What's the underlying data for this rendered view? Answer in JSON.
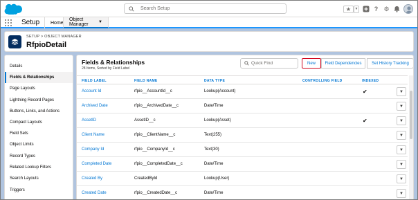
{
  "header": {
    "search_placeholder": "Search Setup",
    "icons": [
      "star-icon",
      "chevron-down-icon",
      "plus-icon",
      "help-icon",
      "gear-icon",
      "bell-icon",
      "avatar"
    ]
  },
  "context_bar": {
    "app_name": "Setup",
    "tabs": [
      {
        "label": "Home"
      },
      {
        "label": "Object Manager"
      }
    ]
  },
  "page_header": {
    "breadcrumb": "SETUP > OBJECT MANAGER",
    "title": "RfpioDetail"
  },
  "sidebar": {
    "items": [
      {
        "label": "Details"
      },
      {
        "label": "Fields & Relationships"
      },
      {
        "label": "Page Layouts"
      },
      {
        "label": "Lightning Record Pages"
      },
      {
        "label": "Buttons, Links, and Actions"
      },
      {
        "label": "Compact Layouts"
      },
      {
        "label": "Field Sets"
      },
      {
        "label": "Object Limits"
      },
      {
        "label": "Record Types"
      },
      {
        "label": "Related Lookup Filters"
      },
      {
        "label": "Search Layouts"
      },
      {
        "label": "Triggers"
      }
    ],
    "active_index": 1
  },
  "main": {
    "title": "Fields & Relationships",
    "subtitle": "28 Items, Sorted by Field Label",
    "quick_find_placeholder": "Quick Find",
    "buttons": {
      "new": "New",
      "field_dependencies": "Field Dependencies",
      "set_history_tracking": "Set History Tracking"
    },
    "columns": [
      "FIELD LABEL",
      "FIELD NAME",
      "DATA TYPE",
      "CONTROLLING FIELD",
      "INDEXED"
    ],
    "rows": [
      {
        "label": "Account Id",
        "name": "rfpio__AccountId__c",
        "type": "Lookup(Account)",
        "controlling": "",
        "indexed": "✔"
      },
      {
        "label": "Archived Date",
        "name": "rfpio__ArchivedDate__c",
        "type": "Date/Time",
        "controlling": "",
        "indexed": ""
      },
      {
        "label": "AssetID",
        "name": "AssetID__c",
        "type": "Lookup(Asset)",
        "controlling": "",
        "indexed": "✔"
      },
      {
        "label": "Client Name",
        "name": "rfpio__ClientName__c",
        "type": "Text(255)",
        "controlling": "",
        "indexed": ""
      },
      {
        "label": "Company Id",
        "name": "rfpio__CompanyId__c",
        "type": "Text(30)",
        "controlling": "",
        "indexed": ""
      },
      {
        "label": "Completed Date",
        "name": "rfpio__CompletedDate__c",
        "type": "Date/Time",
        "controlling": "",
        "indexed": ""
      },
      {
        "label": "Created By",
        "name": "CreatedById",
        "type": "Lookup(User)",
        "controlling": "",
        "indexed": ""
      },
      {
        "label": "Created Date",
        "name": "rfpio__CreatedDate__c",
        "type": "Date/Time",
        "controlling": "",
        "indexed": ""
      }
    ]
  },
  "colors": {
    "brand_blue": "#0176d3",
    "cloud_blue": "#00a1e0",
    "highlight_red": "#d0021b",
    "icon_navy": "#032d60"
  }
}
